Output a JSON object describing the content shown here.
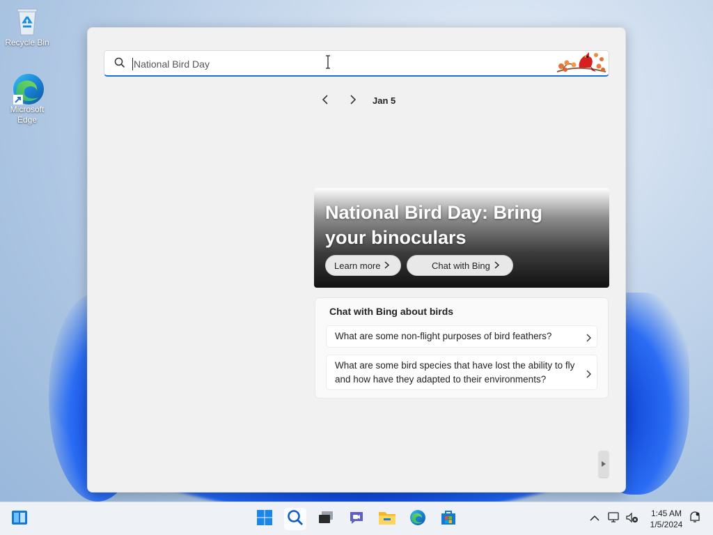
{
  "desktop": {
    "icons": [
      {
        "label": "Recycle Bin",
        "icon": "recycle-bin-icon"
      },
      {
        "label": "Microsoft Edge",
        "icon": "edge-icon"
      }
    ]
  },
  "search": {
    "value": "National Bird Day",
    "placeholder": "National Bird Day",
    "decoration": "cardinal-bird-icon"
  },
  "nav": {
    "date": "Jan 5",
    "prev_icon": "chevron-left-icon",
    "next_icon": "chevron-right-icon"
  },
  "hero": {
    "title": "National Bird Day: Bring your binoculars",
    "learn_more": "Learn more",
    "chat_with_bing": "Chat with Bing"
  },
  "chat_card": {
    "title": "Chat with Bing about birds",
    "questions": [
      "What are some non-flight purposes of bird feathers?",
      "What are some bird species that have lost the ability to fly and how have they adapted to their environments?"
    ]
  },
  "taskbar": {
    "items": [
      "widgets-icon",
      "start-icon",
      "search-icon",
      "task-view-icon",
      "teams-chat-icon",
      "file-explorer-icon",
      "edge-icon",
      "store-icon"
    ],
    "clock": {
      "time": "1:45 AM",
      "date": "1/5/2024"
    }
  },
  "colors": {
    "accent": "#1a6dd3",
    "panel_bg": "#f1f1f1"
  }
}
